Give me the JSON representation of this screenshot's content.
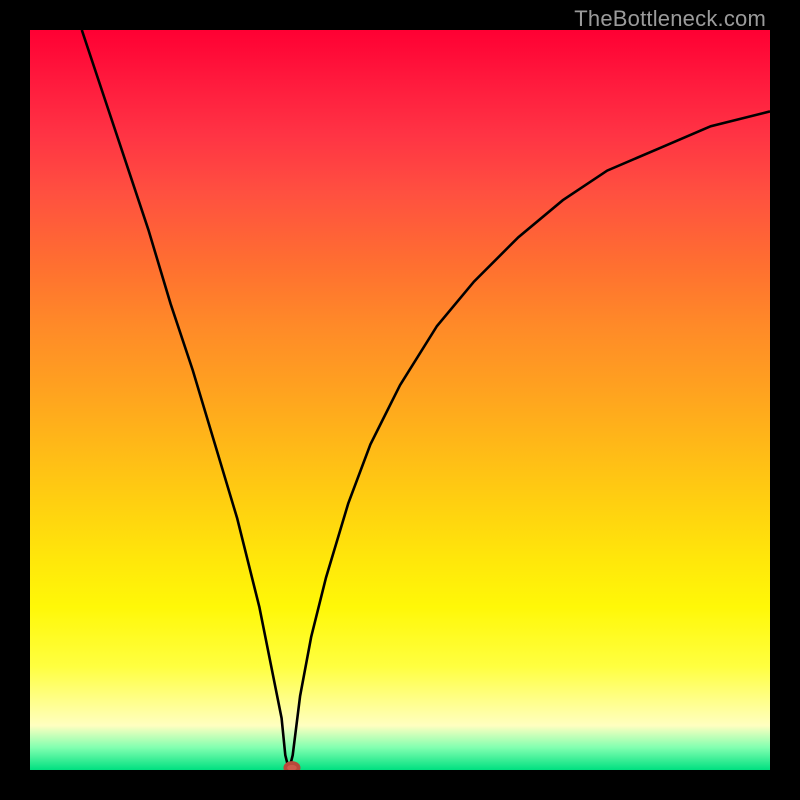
{
  "watermark": "TheBottleneck.com",
  "chart_data": {
    "type": "line",
    "title": "",
    "xlabel": "",
    "ylabel": "",
    "xlim": [
      0,
      100
    ],
    "ylim": [
      0,
      100
    ],
    "grid": false,
    "series": [
      {
        "name": "curve",
        "x": [
          7,
          10,
          13,
          16,
          19,
          22,
          25,
          28,
          31,
          34,
          34.5,
          35,
          35.5,
          36,
          36.5,
          38,
          40,
          43,
          46,
          50,
          55,
          60,
          66,
          72,
          78,
          85,
          92,
          100
        ],
        "y": [
          100,
          91,
          82,
          73,
          63,
          54,
          44,
          34,
          22,
          7,
          2,
          0,
          2,
          6,
          10,
          18,
          26,
          36,
          44,
          52,
          60,
          66,
          72,
          77,
          81,
          84,
          87,
          89
        ]
      }
    ],
    "marker": {
      "x": 35.4,
      "y": 0.3,
      "rx": 0.9,
      "ry": 0.65
    },
    "colors": {
      "curve": "#000000",
      "marker": "#cc5a4a",
      "background_top": "#ff0033",
      "background_bottom": "#00e080",
      "frame": "#000000"
    }
  }
}
